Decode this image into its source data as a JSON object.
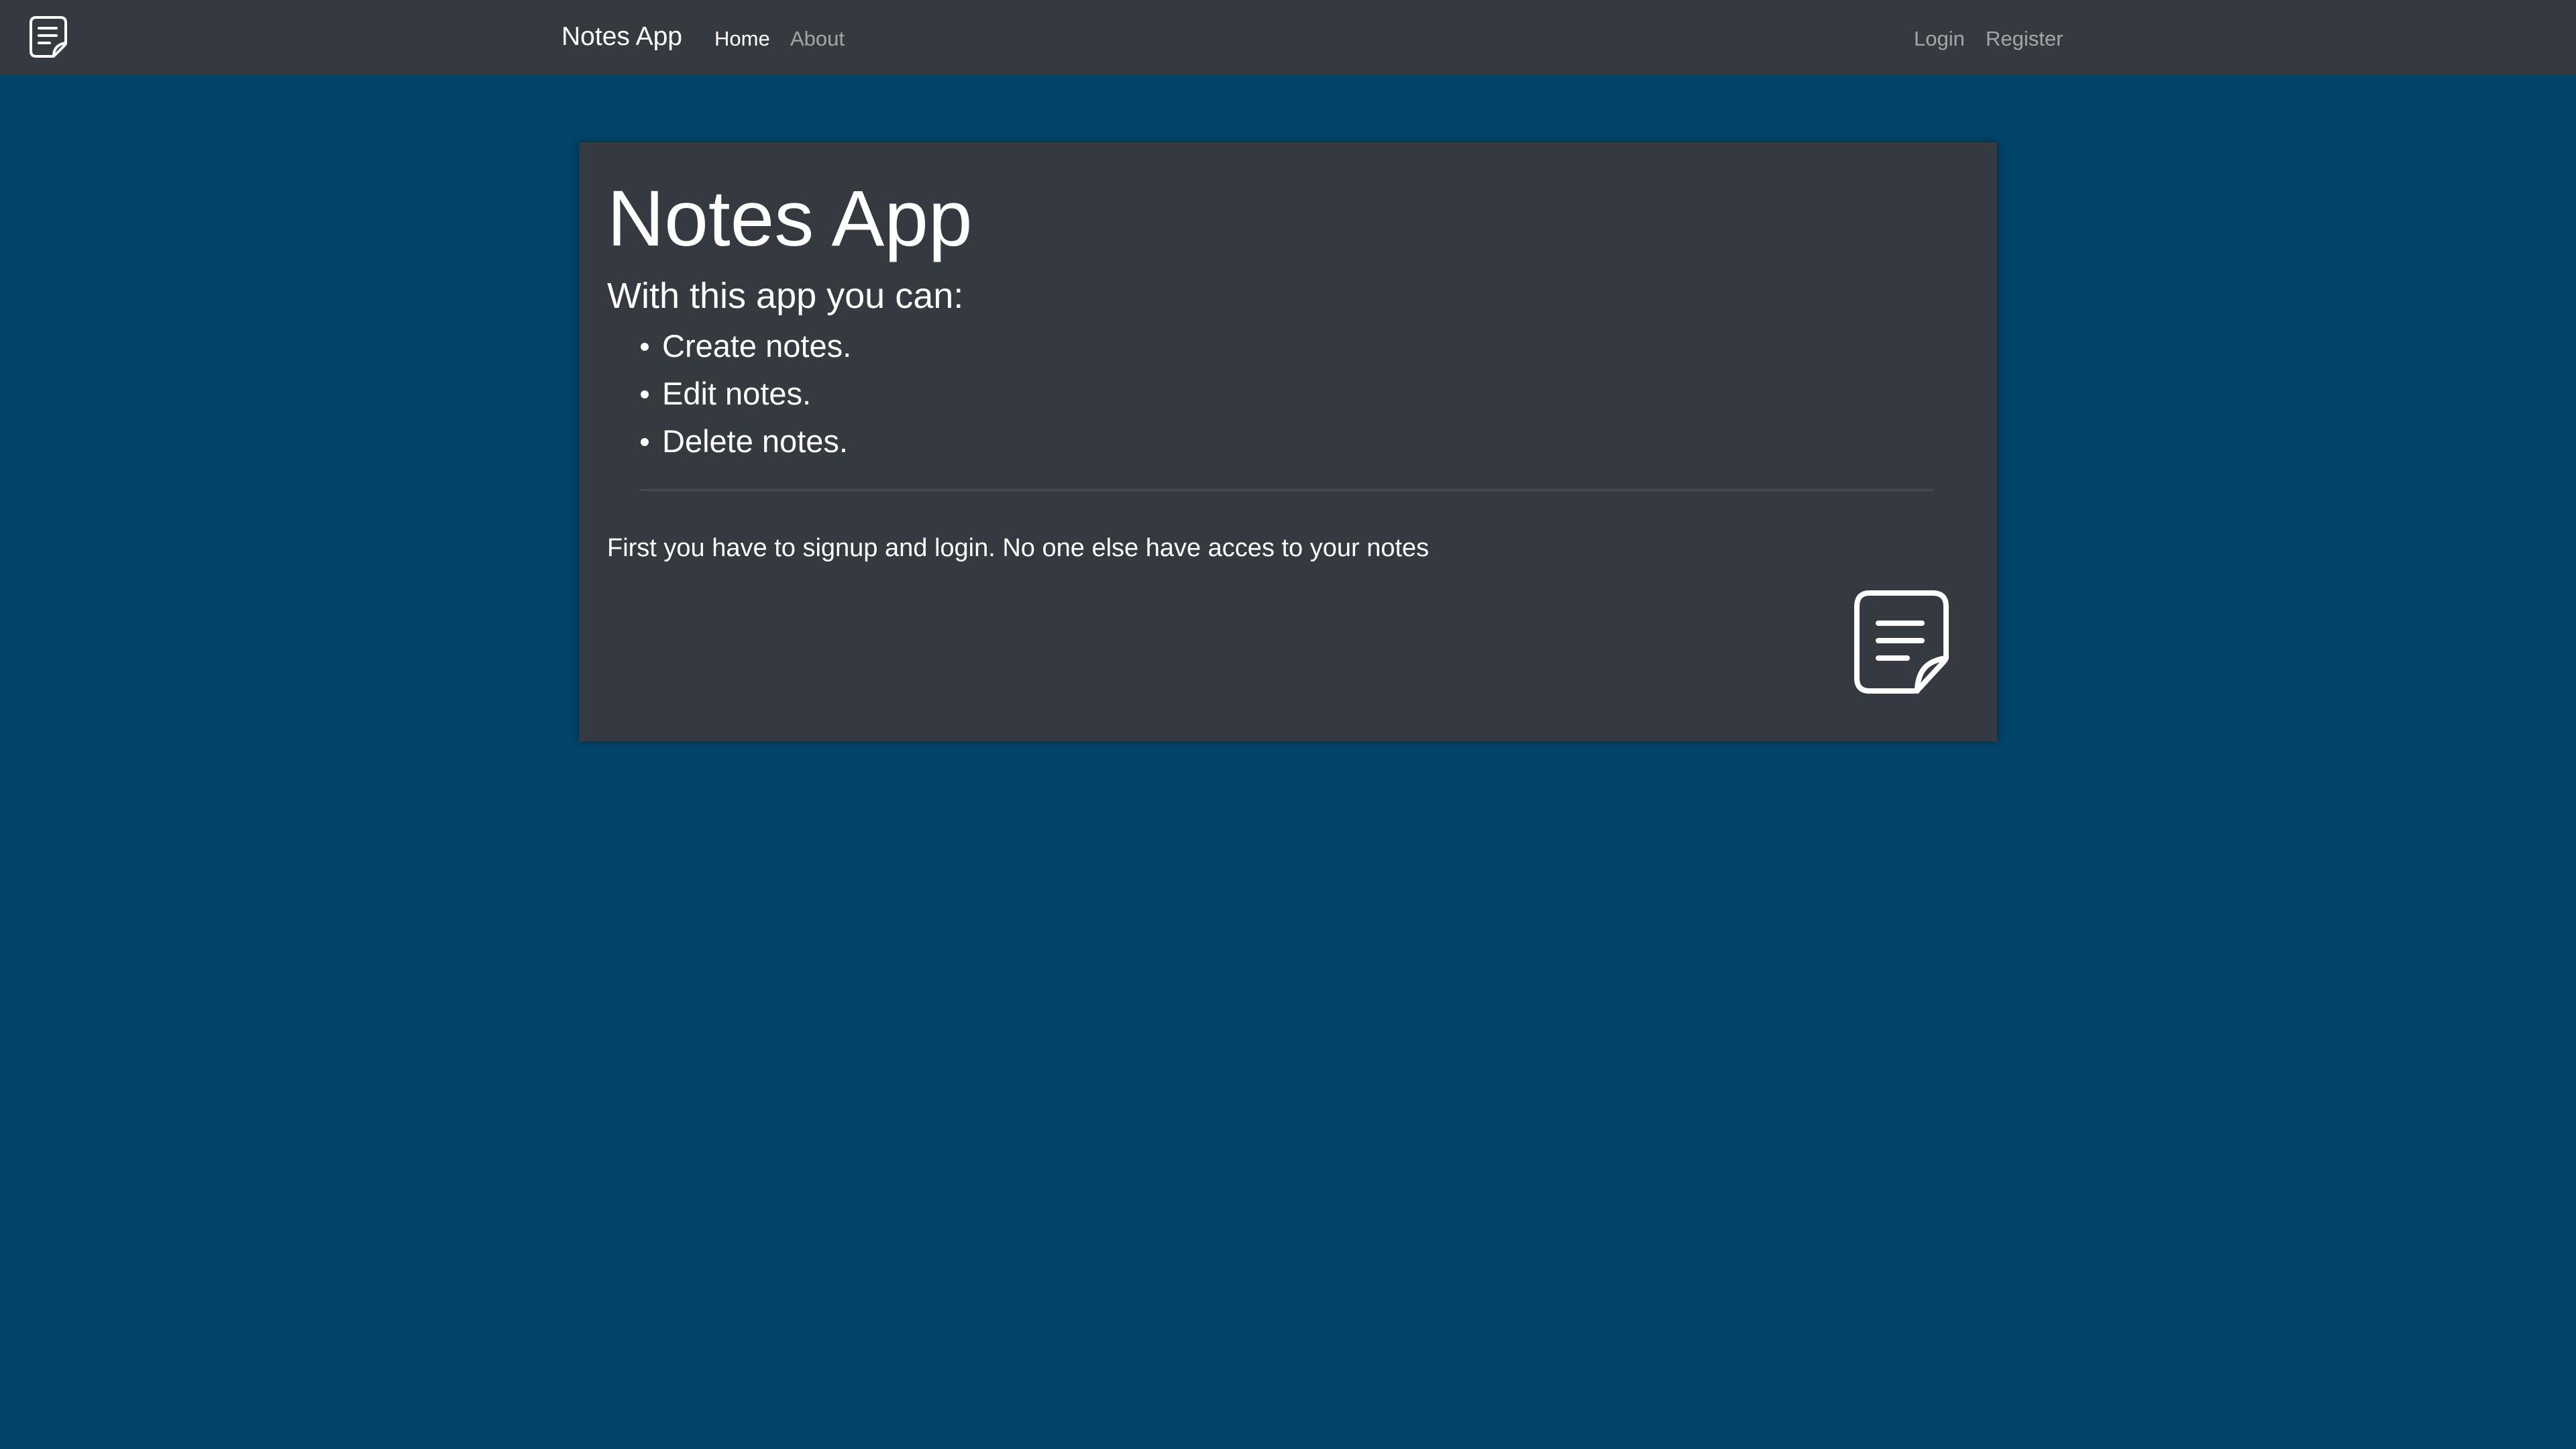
{
  "navbar": {
    "logo_icon": "note-icon",
    "brand": "Notes App",
    "links": {
      "home": "Home",
      "about": "About",
      "login": "Login",
      "register": "Register"
    },
    "colors": {
      "background": "#343a40",
      "active_link": "#ffffff",
      "inactive_link": "rgba(255,255,255,0.55)"
    }
  },
  "page": {
    "background": "#00446a"
  },
  "card": {
    "title": "Notes App",
    "subtitle": "With this app you can:",
    "features": [
      "Create notes.",
      "Edit notes.",
      "Delete notes."
    ],
    "info": "First you have to signup and login. No one else have acces to your notes",
    "icon": "note-icon",
    "background": "#343a40"
  }
}
